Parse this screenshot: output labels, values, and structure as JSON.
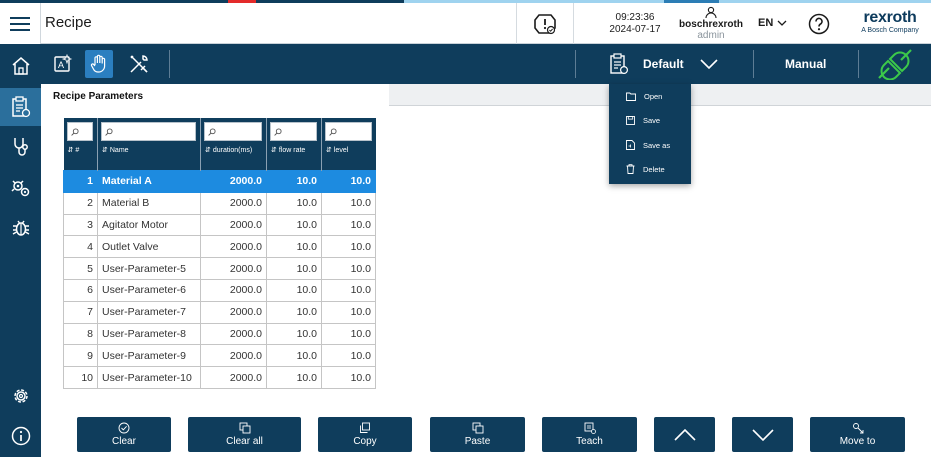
{
  "colors": {
    "navy": "#0f3d5c",
    "accent_blue": "#1d8be0",
    "active_blue": "#2b7fc0",
    "status_green": "#3cc94a",
    "strip_red": "#e32a2a"
  },
  "header": {
    "title": "Recipe",
    "time": "09:23:36",
    "date": "2024-07-17",
    "user_name": "boschrexroth",
    "user_role": "admin",
    "language": "EN",
    "brand_name": "rexroth",
    "brand_sub": "A Bosch Company"
  },
  "sidebar": {
    "items": [
      {
        "icon": "home-icon"
      },
      {
        "icon": "recipe-clipboard-icon",
        "active": true
      },
      {
        "icon": "stethoscope-icon"
      },
      {
        "icon": "gears-icon"
      },
      {
        "icon": "bug-icon"
      },
      {
        "icon": "gear-icon"
      },
      {
        "icon": "info-icon"
      }
    ]
  },
  "toolbar": {
    "recipe_name": "Default",
    "mode": "Manual"
  },
  "panel": {
    "title": "Recipe Parameters"
  },
  "table": {
    "columns": [
      "#",
      "Name",
      "duration(ms)",
      "flow rate",
      "level"
    ],
    "rows": [
      {
        "index": "1",
        "name": "Material A",
        "duration": "2000.0",
        "flow": "10.0",
        "level": "10.0"
      },
      {
        "index": "2",
        "name": "Material B",
        "duration": "2000.0",
        "flow": "10.0",
        "level": "10.0"
      },
      {
        "index": "3",
        "name": "Agitator Motor",
        "duration": "2000.0",
        "flow": "10.0",
        "level": "10.0"
      },
      {
        "index": "4",
        "name": "Outlet Valve",
        "duration": "2000.0",
        "flow": "10.0",
        "level": "10.0"
      },
      {
        "index": "5",
        "name": "User-Parameter-5",
        "duration": "2000.0",
        "flow": "10.0",
        "level": "10.0"
      },
      {
        "index": "6",
        "name": "User-Parameter-6",
        "duration": "2000.0",
        "flow": "10.0",
        "level": "10.0"
      },
      {
        "index": "7",
        "name": "User-Parameter-7",
        "duration": "2000.0",
        "flow": "10.0",
        "level": "10.0"
      },
      {
        "index": "8",
        "name": "User-Parameter-8",
        "duration": "2000.0",
        "flow": "10.0",
        "level": "10.0"
      },
      {
        "index": "9",
        "name": "User-Parameter-9",
        "duration": "2000.0",
        "flow": "10.0",
        "level": "10.0"
      },
      {
        "index": "10",
        "name": "User-Parameter-10",
        "duration": "2000.0",
        "flow": "10.0",
        "level": "10.0"
      }
    ]
  },
  "menu": {
    "items": [
      "Open",
      "Save",
      "Save as",
      "Delete"
    ]
  },
  "actions": {
    "clear": "Clear",
    "clear_all": "Clear all",
    "copy": "Copy",
    "paste": "Paste",
    "teach": "Teach",
    "move_to": "Move to"
  }
}
